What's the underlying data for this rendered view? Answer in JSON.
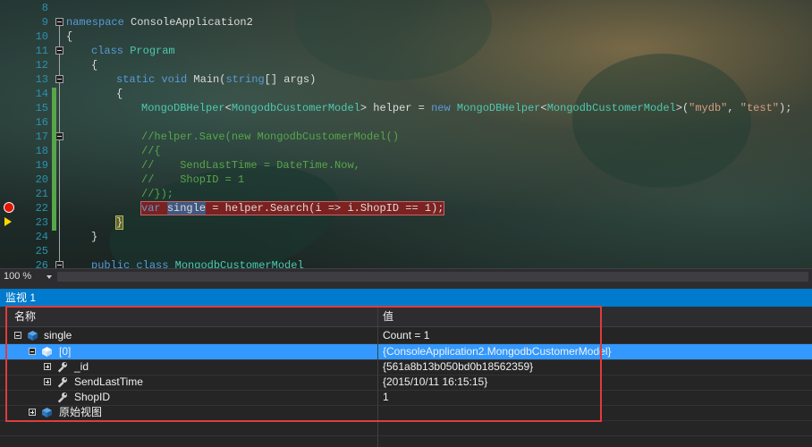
{
  "editor": {
    "lines": [
      {
        "num": "8",
        "text": ""
      },
      {
        "num": "9",
        "text": "namespace ConsoleApplication2"
      },
      {
        "num": "10",
        "text": "{"
      },
      {
        "num": "11",
        "text": "class Program"
      },
      {
        "num": "12",
        "text": "{"
      },
      {
        "num": "13",
        "text": "static void Main(string[] args)"
      },
      {
        "num": "14",
        "text": "{"
      },
      {
        "num": "15",
        "text": "MongoDBHelper<MongodbCustomerModel> helper = new MongoDBHelper<MongodbCustomerModel>(\"mydb\", \"test\");"
      },
      {
        "num": "16",
        "text": ""
      },
      {
        "num": "17",
        "text": "//helper.Save(new MongodbCustomerModel()"
      },
      {
        "num": "18",
        "text": "//{"
      },
      {
        "num": "19",
        "text": "//    SendLastTime = DateTime.Now,"
      },
      {
        "num": "20",
        "text": "//    ShopID = 1"
      },
      {
        "num": "21",
        "text": "//});"
      },
      {
        "num": "22",
        "text": "var single = helper.Search(i => i.ShopID == 1);"
      },
      {
        "num": "23",
        "text": "}"
      },
      {
        "num": "24",
        "text": "}"
      },
      {
        "num": "25",
        "text": ""
      },
      {
        "num": "26",
        "text": "public class MongodbCustomerModel"
      }
    ],
    "tokens": {
      "namespace": "namespace",
      "ns_name": " ConsoleApplication2",
      "class_kw": "class",
      "class_name": "Program",
      "static": "static",
      "void": "void",
      "main": " Main(",
      "string": "string",
      "args": "[] args)",
      "helper_type": "MongoDBHelper",
      "lt": "<",
      "model_type": "MongodbCustomerModel",
      "gt_helper": "> helper = ",
      "new_kw": "new",
      "helper_type2": "MongoDBHelper",
      "lt2": "<",
      "model_type2": "MongodbCustomerModel",
      "gt2": ">(",
      "str_mydb": "\"mydb\"",
      "comma": ", ",
      "str_test": "\"test\"",
      "close": ");",
      "var_kw": "var",
      "space": " ",
      "single": "single",
      "search_rest": " = helper.Search(i => i.ShopID == 1);",
      "public_kw": "public",
      "class_kw2": "class",
      "model_name": "MongodbCustomerModel"
    },
    "zoom": "100 %"
  },
  "watch": {
    "tab_title": "监视 1",
    "col_name": "名称",
    "col_value": "值",
    "rows": [
      {
        "name": "single",
        "value": "Count = 1"
      },
      {
        "name": "[0]",
        "value": "{ConsoleApplication2.MongodbCustomerModel}"
      },
      {
        "name": "_id",
        "value": "{561a8b13b050bd0b18562359}"
      },
      {
        "name": "SendLastTime",
        "value": "{2015/10/11 16:15:15}"
      },
      {
        "name": "ShopID",
        "value": "1"
      },
      {
        "name": "原始视图",
        "value": ""
      }
    ]
  },
  "colors": {
    "accent": "#007acc",
    "breakpoint": "#e51400",
    "selection": "#3399ff",
    "annotation_frame": "#e03c3c"
  }
}
